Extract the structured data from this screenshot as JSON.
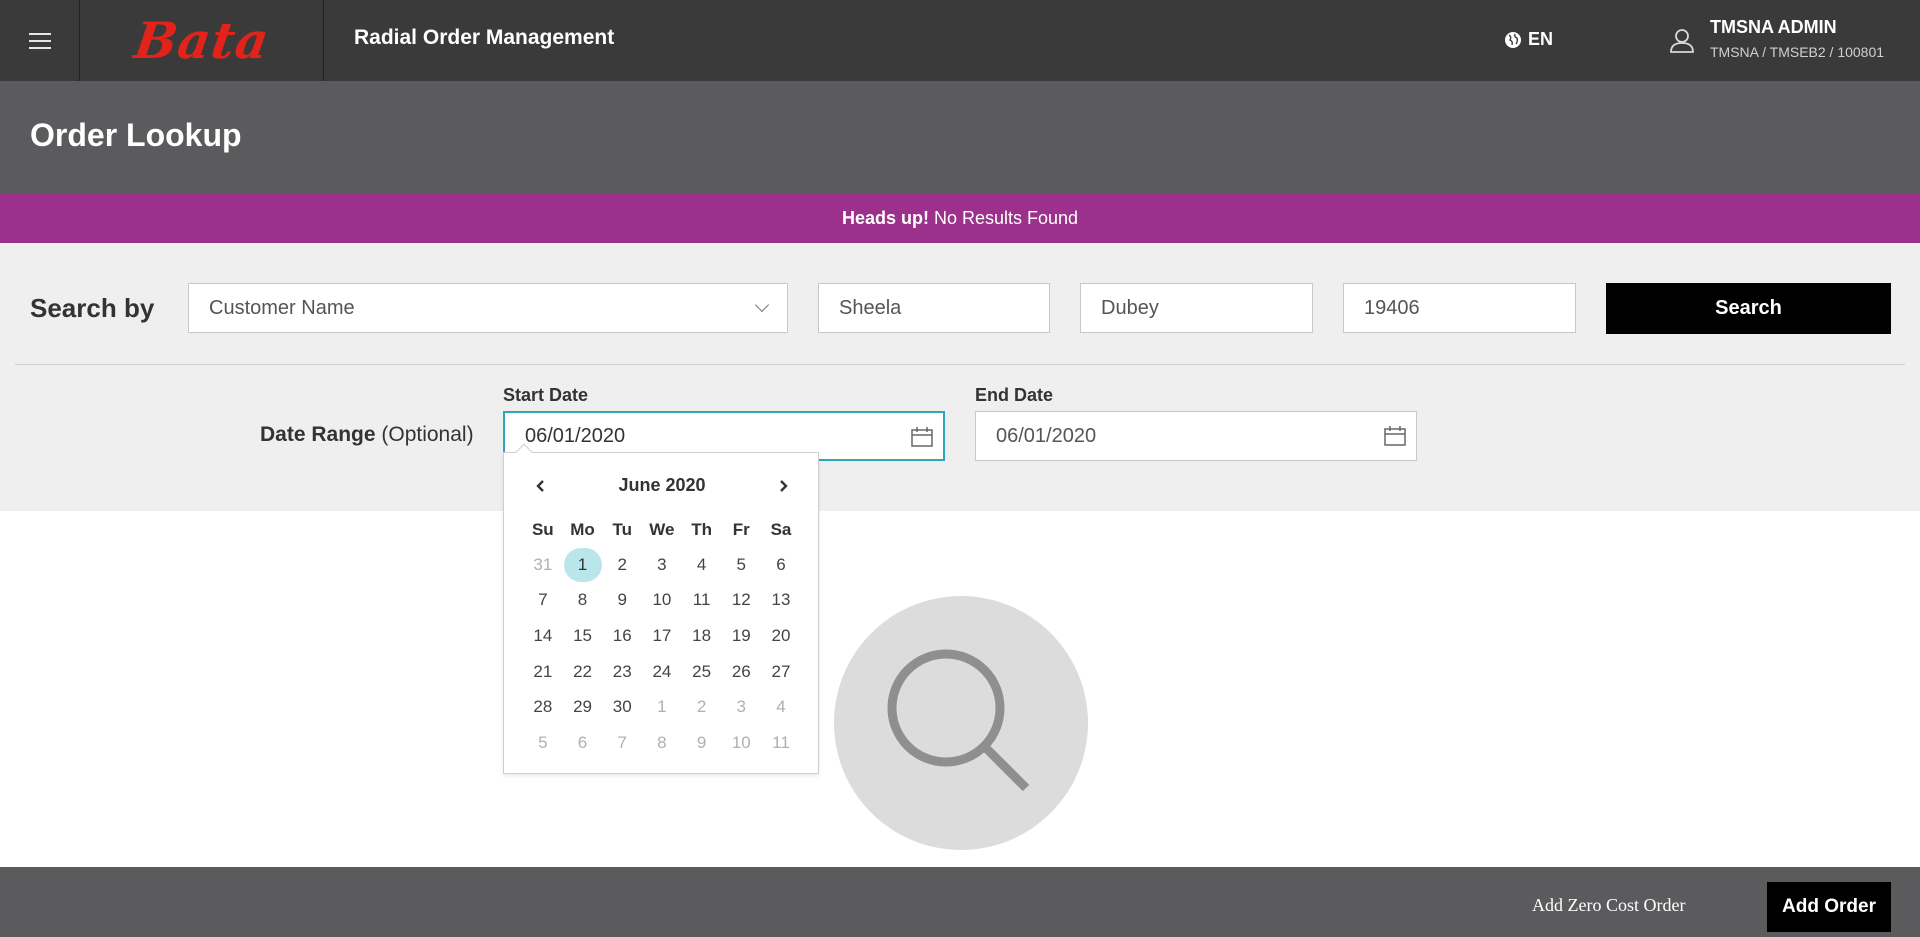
{
  "header": {
    "brand_logo": "Bata",
    "app_title": "Radial Order Management",
    "language": "EN",
    "user_name": "TMSNA ADMIN",
    "user_path": "TMSNA / TMSEB2 / 100801"
  },
  "page": {
    "title": "Order Lookup"
  },
  "alert": {
    "strong": "Heads up!",
    "message": "No Results Found",
    "color": "#9b318b"
  },
  "search": {
    "label": "Search by",
    "type_selected": "Customer Name",
    "first_name": "Sheela",
    "last_name": "Dubey",
    "zip": "19406",
    "button_label": "Search"
  },
  "date_range": {
    "label": "Date Range",
    "optional": "(Optional)",
    "start_label": "Start Date",
    "start_value": "06/01/2020",
    "end_label": "End Date",
    "end_value": "06/01/2020"
  },
  "calendar": {
    "month_title": "June 2020",
    "weekdays": [
      "Su",
      "Mo",
      "Tu",
      "We",
      "Th",
      "Fr",
      "Sa"
    ],
    "weeks": [
      [
        {
          "d": "31",
          "o": true
        },
        {
          "d": "1",
          "s": true
        },
        {
          "d": "2"
        },
        {
          "d": "3"
        },
        {
          "d": "4"
        },
        {
          "d": "5"
        },
        {
          "d": "6"
        }
      ],
      [
        {
          "d": "7"
        },
        {
          "d": "8"
        },
        {
          "d": "9"
        },
        {
          "d": "10"
        },
        {
          "d": "11"
        },
        {
          "d": "12"
        },
        {
          "d": "13"
        }
      ],
      [
        {
          "d": "14"
        },
        {
          "d": "15"
        },
        {
          "d": "16"
        },
        {
          "d": "17"
        },
        {
          "d": "18"
        },
        {
          "d": "19"
        },
        {
          "d": "20"
        }
      ],
      [
        {
          "d": "21"
        },
        {
          "d": "22"
        },
        {
          "d": "23"
        },
        {
          "d": "24"
        },
        {
          "d": "25"
        },
        {
          "d": "26"
        },
        {
          "d": "27"
        }
      ],
      [
        {
          "d": "28"
        },
        {
          "d": "29"
        },
        {
          "d": "30"
        },
        {
          "d": "1",
          "o": true
        },
        {
          "d": "2",
          "o": true
        },
        {
          "d": "3",
          "o": true
        },
        {
          "d": "4",
          "o": true
        }
      ],
      [
        {
          "d": "5",
          "o": true
        },
        {
          "d": "6",
          "o": true
        },
        {
          "d": "7",
          "o": true
        },
        {
          "d": "8",
          "o": true
        },
        {
          "d": "9",
          "o": true
        },
        {
          "d": "10",
          "o": true
        },
        {
          "d": "11",
          "o": true
        }
      ]
    ],
    "selected_color": "#b9e6ea"
  },
  "footer": {
    "zero_cost_label": "Add Zero Cost Order",
    "add_order_label": "Add Order"
  },
  "icons": {
    "menu": "hamburger-menu-icon",
    "language": "globe-icon",
    "user": "user-icon",
    "dropdown": "chevron-down-icon",
    "calendar": "calendar-icon",
    "prev": "chevron-left-icon",
    "next": "chevron-right-icon",
    "empty": "search-magnifier-icon"
  }
}
